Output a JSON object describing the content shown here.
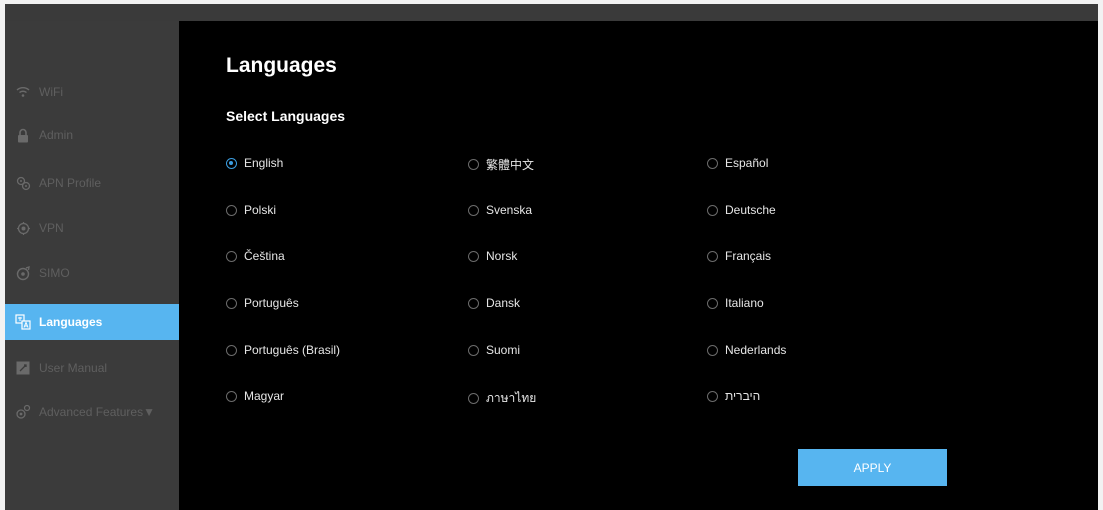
{
  "sidebar": {
    "items": [
      {
        "label": "WiFi",
        "icon": "wifi-icon"
      },
      {
        "label": "Admin",
        "icon": "lock-icon"
      },
      {
        "label": "APN Profile",
        "icon": "apn-profile-icon"
      },
      {
        "label": "VPN",
        "icon": "vpn-icon"
      },
      {
        "label": "SIMO",
        "icon": "simo-icon"
      },
      {
        "label": "Languages",
        "icon": "languages-icon",
        "active": true
      },
      {
        "label": "User Manual",
        "icon": "manual-icon"
      },
      {
        "label": "Advanced Features▼",
        "icon": "advanced-features-icon"
      }
    ]
  },
  "main": {
    "title": "Languages",
    "section_title": "Select Languages",
    "selected_language": "English",
    "languages": [
      [
        "English",
        "繁體中文",
        "Español"
      ],
      [
        "Polski",
        "Svenska",
        "Deutsche"
      ],
      [
        "Čeština",
        "Norsk",
        "Français"
      ],
      [
        "Português",
        "Dansk",
        "Italiano"
      ],
      [
        "Português (Brasil)",
        "Suomi",
        "Nederlands"
      ],
      [
        "Magyar",
        "ภาษาไทย",
        "היברית"
      ]
    ],
    "apply_label": "APPLY"
  },
  "colors": {
    "accent": "#57b5f0",
    "radio_selected": "#3b9de0",
    "sidebar_bg": "#3b3b3b",
    "main_bg": "#000000"
  }
}
